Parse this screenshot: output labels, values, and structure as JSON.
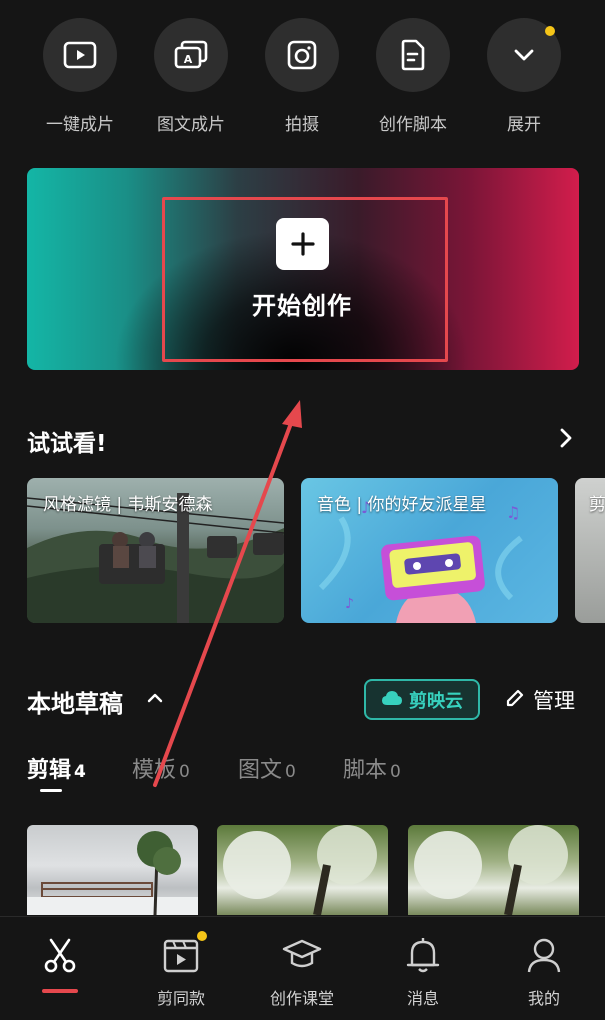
{
  "quick_actions": [
    {
      "label": "一键成片",
      "icon": "play-icon"
    },
    {
      "label": "图文成片",
      "icon": "text-layers-icon"
    },
    {
      "label": "拍摄",
      "icon": "camera-icon"
    },
    {
      "label": "创作脚本",
      "icon": "script-icon"
    },
    {
      "label": "展开",
      "icon": "chevron-down-icon"
    }
  ],
  "banner": {
    "create_label": "开始创作",
    "icon": "plus-icon"
  },
  "try_section": {
    "title": "试试看!",
    "cards": [
      {
        "title": "风格滤镜 | 韦斯安德森"
      },
      {
        "title": "音色 | 你的好友派星星"
      },
      {
        "title": "剪"
      }
    ]
  },
  "drafts": {
    "title": "本地草稿",
    "cloud_label": "剪映云",
    "manage_label": "管理",
    "tabs": [
      {
        "label": "剪辑",
        "count": "4"
      },
      {
        "label": "模板",
        "count": "0"
      },
      {
        "label": "图文",
        "count": "0"
      },
      {
        "label": "脚本",
        "count": "0"
      }
    ]
  },
  "bottom_nav": [
    {
      "label": "",
      "icon": "scissors-icon"
    },
    {
      "label": "剪同款",
      "icon": "clapper-icon"
    },
    {
      "label": "创作课堂",
      "icon": "graduation-cap-icon"
    },
    {
      "label": "消息",
      "icon": "bell-icon"
    },
    {
      "label": "我的",
      "icon": "person-icon"
    }
  ],
  "colors": {
    "accent_red": "#e5484d",
    "accent_teal": "#2fb8a8",
    "notice_dot": "#f5c518"
  }
}
